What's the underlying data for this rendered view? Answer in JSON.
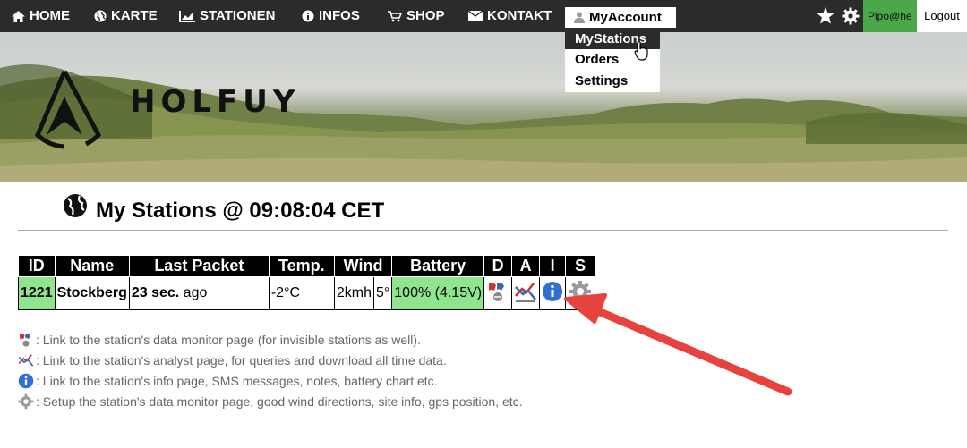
{
  "nav": {
    "items": [
      {
        "label": "HOME",
        "icon": "home-icon"
      },
      {
        "label": "KARTE",
        "icon": "globe-icon"
      },
      {
        "label": "STATIONEN",
        "icon": "chart-icon"
      },
      {
        "label": "INFOS",
        "icon": "info-icon"
      },
      {
        "label": "SHOP",
        "icon": "cart-icon"
      },
      {
        "label": "KONTAKT",
        "icon": "envelope-icon"
      }
    ],
    "account_label": "MyAccount",
    "user": "Pipo@he",
    "logout": "Logout"
  },
  "dropdown": {
    "items": [
      "MyStations",
      "Orders",
      "Settings"
    ],
    "active": "MyStations"
  },
  "banner": {
    "logo": "HOLFUY"
  },
  "page": {
    "title": "My Stations @ 09:08:04 CET"
  },
  "table": {
    "headers": [
      "ID",
      "Name",
      "Last Packet",
      "Temp.",
      "Wind",
      "Battery",
      "D",
      "A",
      "I",
      "S"
    ],
    "row": {
      "id": "1221",
      "name": "Stockberg",
      "last_packet_value": "23 sec.",
      "last_packet_suffix": " ago",
      "temp": "-2°C",
      "wind_speed": "2kmh",
      "wind_dir": "5°",
      "battery": "100% (4.15V)"
    }
  },
  "legend": [
    ": Link to the station's data monitor page (for invisible stations as well).",
    ": Link to the station's analyst page, for queries and download all time data.",
    ": Link to the station's info page, SMS messages, notes, battery chart etc.",
    ": Setup the station's data monitor page, good wind directions, site info, gps position, etc."
  ],
  "colors": {
    "nav_bg": "#2b2b2b",
    "user_bg": "#4aa84a",
    "green_cell": "#8ee58e",
    "arrow": "#e8423f"
  }
}
